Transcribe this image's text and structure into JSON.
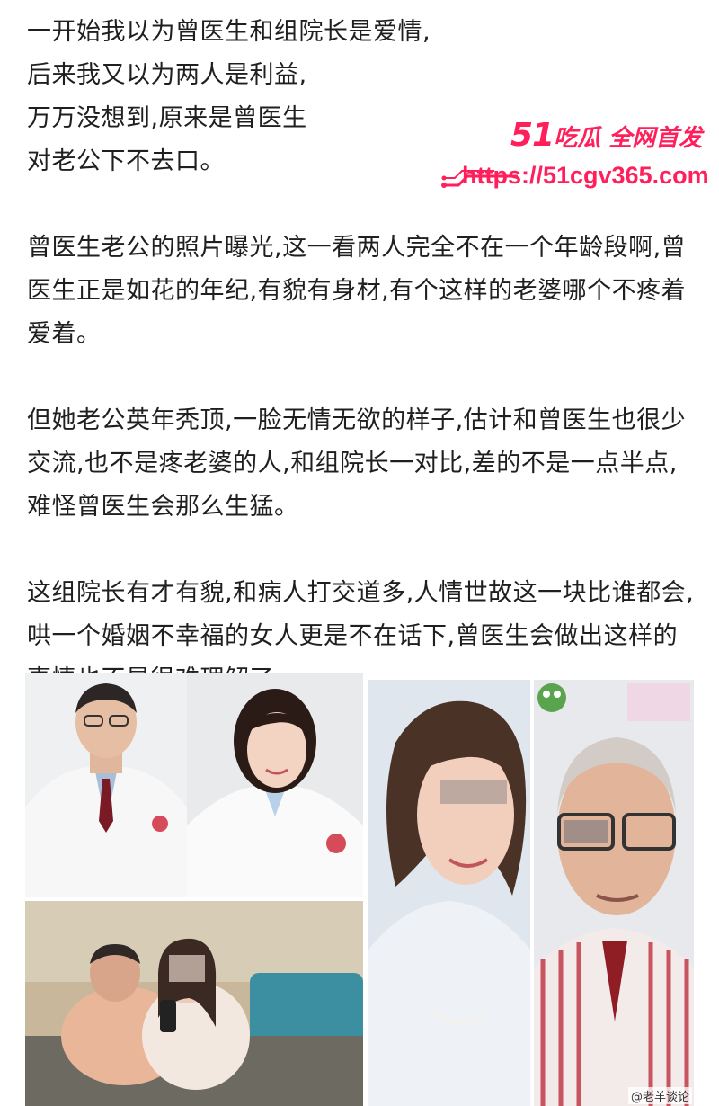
{
  "article": {
    "paragraphs": [
      "一开始我以为曾医生和组院长是爱情,\n后来我又以为两人是利益,\n万万没想到,原来是曾医生\n对老公下不去口。",
      "曾医生老公的照片曝光,这一看两人完全不在一个年龄段啊,曾医生正是如花的年纪,有貌有身材,有个这样的老婆哪个不疼着爱着。",
      "但她老公英年秃顶,一脸无情无欲的样子,估计和曾医生也很少交流,也不是疼老婆的人,和组院长一对比,差的不是一点半点,难怪曾医生会那么生猛。",
      "这组院长有才有貌,和病人打交道多,人情世故这一块比谁都会,哄一个婚姻不幸福的女人更是不在话下,曾医生会做出这样的事情也不是很难理解了。"
    ]
  },
  "watermark": {
    "brand_number": "51",
    "brand_text": "吃瓜 全网首发",
    "url": "https://51cgv365.com",
    "color": "#ff1f5a"
  },
  "collage": {
    "photos": [
      {
        "name": "photo-male-doctor",
        "icon": "male-doctor-portrait"
      },
      {
        "name": "photo-female-doctor",
        "icon": "female-doctor-portrait"
      },
      {
        "name": "photo-couple-sofa",
        "icon": "couple-photo"
      },
      {
        "name": "photo-woman-closeup",
        "icon": "woman-portrait-blurred"
      },
      {
        "name": "photo-older-man-closeup",
        "icon": "older-man-portrait-blurred"
      }
    ],
    "caption_fragment": "@老羊谈论"
  }
}
